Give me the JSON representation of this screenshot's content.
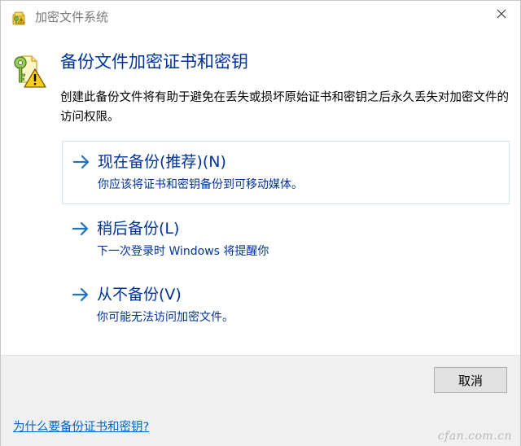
{
  "window": {
    "title": "加密文件系统",
    "close_icon": "close-icon"
  },
  "main": {
    "heading": "备份文件加密证书和密钥",
    "description": "创建此备份文件将有助于避免在丢失或损坏原始证书和密钥之后永久丢失对加密文件的访问权限。",
    "icon": "key-warning-icon"
  },
  "options": [
    {
      "title": "现在备份(推荐)(N)",
      "description": "你应该将证书和密钥备份到可移动媒体。",
      "selected": true
    },
    {
      "title": "稍后备份(L)",
      "description": "下一次登录时 Windows 将提醒你",
      "selected": false
    },
    {
      "title": "从不备份(V)",
      "description": "你可能无法访问加密文件。",
      "selected": false
    }
  ],
  "footer": {
    "cancel_label": "取消",
    "help_link": "为什么要备份证书和密钥?",
    "watermark": "cfan.com.cn"
  },
  "colors": {
    "link_blue": "#003399",
    "help_link": "#0066cc",
    "footer_bg": "#f0f0f0",
    "arrow": "#1e73be"
  }
}
